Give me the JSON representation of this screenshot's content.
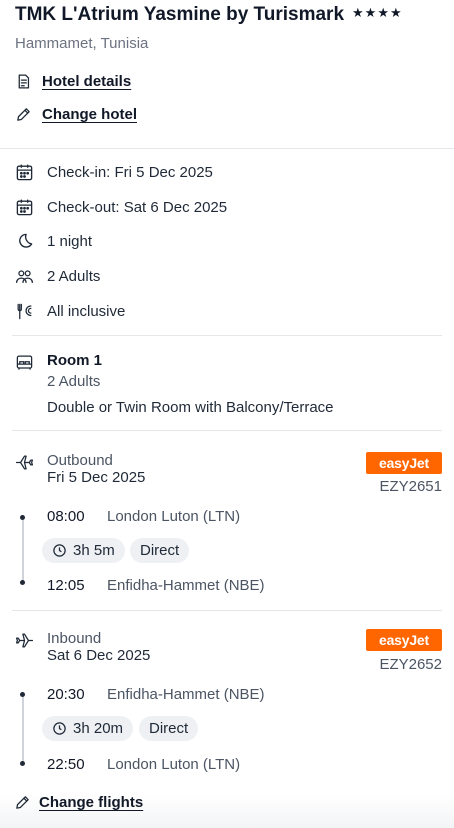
{
  "hotel": {
    "name": "TMK L'Atrium Yasmine by Turismark",
    "stars": "★★★★",
    "location": "Hammamet, Tunisia",
    "details_link": "Hotel details",
    "change_hotel_link": "Change hotel"
  },
  "stay": {
    "check_in": "Check-in: Fri 5 Dec 2025",
    "check_out": "Check-out: Sat 6 Dec 2025",
    "nights": "1 night",
    "guests": "2 Adults",
    "board": "All inclusive"
  },
  "room": {
    "title": "Room 1",
    "occupancy": "2 Adults",
    "type": "Double or Twin Room with Balcony/Terrace"
  },
  "flights": {
    "outbound": {
      "label": "Outbound",
      "date": "Fri 5 Dec 2025",
      "airline": "easyJet",
      "flight_number": "EZY2651",
      "depart_time": "08:00",
      "depart_airport": "London Luton (LTN)",
      "duration": "3h 5m",
      "stops": "Direct",
      "arrive_time": "12:05",
      "arrive_airport": "Enfidha-Hammet (NBE)"
    },
    "inbound": {
      "label": "Inbound",
      "date": "Sat 6 Dec 2025",
      "airline": "easyJet",
      "flight_number": "EZY2652",
      "depart_time": "20:30",
      "depart_airport": "Enfidha-Hammet (NBE)",
      "duration": "3h 20m",
      "stops": "Direct",
      "arrive_time": "22:50",
      "arrive_airport": "London Luton (LTN)"
    },
    "change_flights_link": "Change flights"
  },
  "colors": {
    "airline_brand": "#ff6600",
    "text_primary": "#111827",
    "text_muted": "#6b7280"
  }
}
